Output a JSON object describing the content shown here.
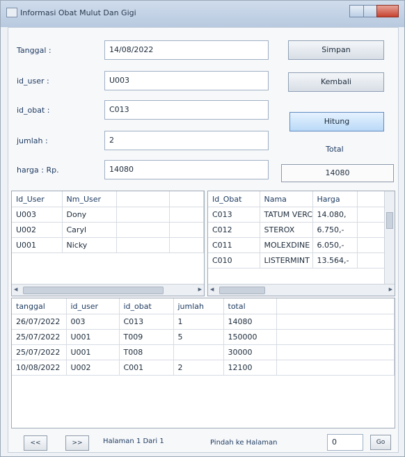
{
  "window": {
    "title": "Informasi Obat Mulut Dan Gigi"
  },
  "form": {
    "tanggal": {
      "label": "Tanggal :",
      "value": "14/08/2022"
    },
    "id_user": {
      "label": "id_user :",
      "value": "U003"
    },
    "id_obat": {
      "label": "id_obat :",
      "value": "C013"
    },
    "jumlah": {
      "label": "jumlah :",
      "value": "2"
    },
    "harga": {
      "label": "harga :  Rp.",
      "value": "14080"
    }
  },
  "buttons": {
    "simpan": "Simpan",
    "kembali": "Kembali",
    "hitung": "Hitung"
  },
  "total": {
    "label": "Total",
    "value": "14080"
  },
  "users_table": {
    "columns": [
      "Id_User",
      "Nm_User",
      "",
      ""
    ],
    "rows": [
      [
        "U003",
        "Dony",
        "",
        ""
      ],
      [
        "U002",
        "Caryl",
        "",
        ""
      ],
      [
        "U001",
        "Nicky",
        "",
        ""
      ]
    ]
  },
  "obat_table": {
    "columns": [
      "Id_Obat",
      "Nama",
      "Harga",
      ""
    ],
    "rows": [
      [
        "C013",
        "TATUM VERC",
        "14.080,",
        ""
      ],
      [
        "C012",
        "STEROX",
        "6.750,-",
        ""
      ],
      [
        "C011",
        "MOLEXDINE",
        "6.050,-",
        ""
      ],
      [
        "C010",
        "LISTERMINT",
        "13.564,-",
        ""
      ]
    ]
  },
  "transaksi_table": {
    "columns": [
      "tanggal",
      "id_user",
      "id_obat",
      "jumlah",
      "total",
      ""
    ],
    "rows": [
      [
        "26/07/2022",
        "003",
        "C013",
        "1",
        "14080",
        ""
      ],
      [
        "25/07/2022",
        "U001",
        "T009",
        "5",
        "150000",
        ""
      ],
      [
        "25/07/2022",
        "U001",
        "T008",
        "",
        "30000",
        ""
      ],
      [
        "10/08/2022",
        "U002",
        "C001",
        "2",
        "12100",
        ""
      ]
    ]
  },
  "pager": {
    "prev": "<<",
    "next": ">>",
    "page_info": "Halaman 1 Dari 1",
    "goto_label": "Pindah ke Halaman",
    "goto_value": "0",
    "go": "Go"
  }
}
